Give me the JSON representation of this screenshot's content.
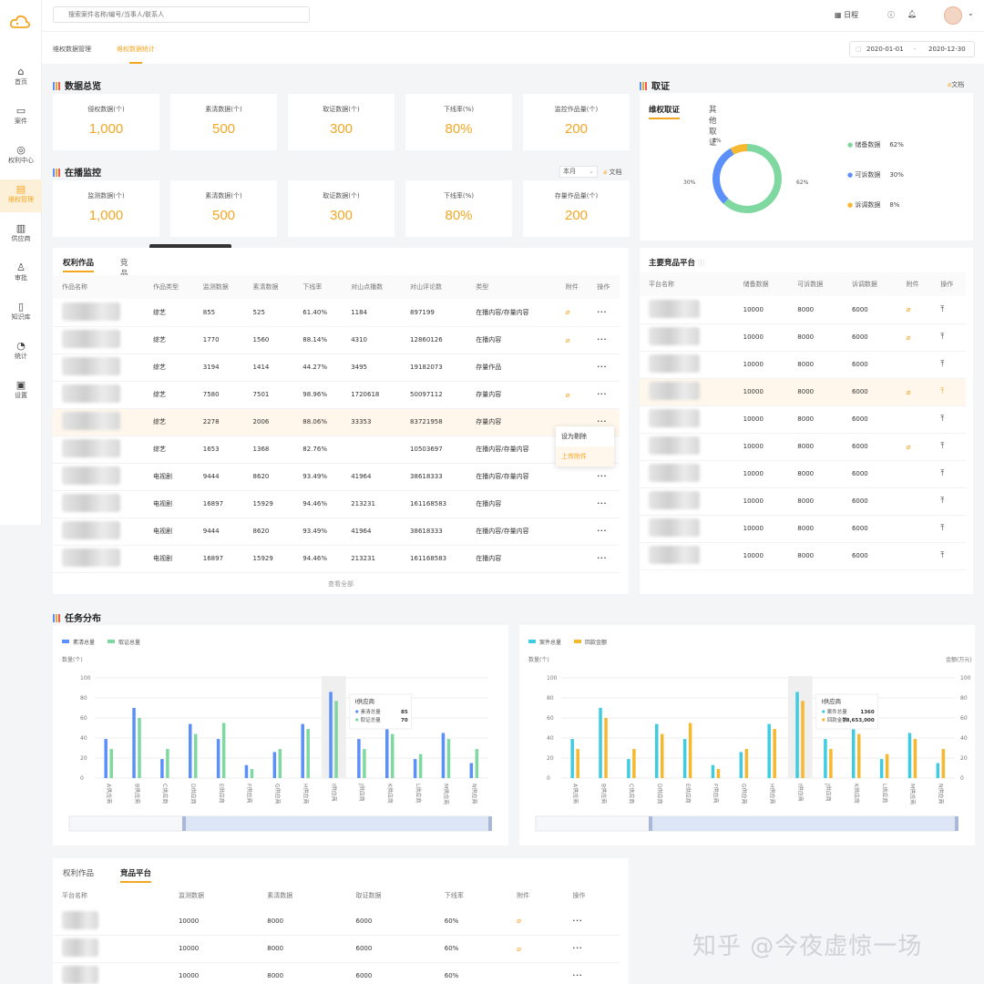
{
  "sidebar": {
    "items": [
      {
        "icon": "home-icon",
        "label": "首页"
      },
      {
        "icon": "case-icon",
        "label": "案件"
      },
      {
        "icon": "rights-icon",
        "label": "权利中心"
      },
      {
        "icon": "rights-mgmt-icon",
        "label": "维权管理"
      },
      {
        "icon": "supplier-icon",
        "label": "供应商"
      },
      {
        "icon": "user-icon",
        "label": "审批"
      },
      {
        "icon": "knowledge-icon",
        "label": "知识库"
      },
      {
        "icon": "stats-icon",
        "label": "统计"
      },
      {
        "icon": "settings-icon",
        "label": "设置"
      }
    ],
    "active": 3
  },
  "topbar": {
    "search_placeholder": "搜索案件名称/编号/当事人/联系人",
    "calendar_label": "日程",
    "help_icon": "help-icon",
    "bell_icon": "bell-icon"
  },
  "subtabs": [
    "维权数据管理",
    "维权数据统计"
  ],
  "date_range": {
    "start": "2020-01-01",
    "sep": "-",
    "end": "2020-12-30"
  },
  "overview": {
    "title": "数据总览",
    "stats": [
      {
        "label": "侵权数据(个)",
        "value": "1,000"
      },
      {
        "label": "素清数据(个)",
        "value": "500"
      },
      {
        "label": "取证数据(个)",
        "value": "300"
      },
      {
        "label": "下线率(%)",
        "value": "80%"
      },
      {
        "label": "监控作品量(个)",
        "value": "200"
      }
    ]
  },
  "monitor": {
    "title": "在播监控",
    "period": "本月",
    "doc": "文档",
    "stats": [
      {
        "label": "监测数据(个)",
        "value": "1,000"
      },
      {
        "label": "素清数据(个)",
        "value": "500"
      },
      {
        "label": "取证数据(个)",
        "value": "300"
      },
      {
        "label": "下线率(%)",
        "value": "80%"
      },
      {
        "label": "存量作品量(个)",
        "value": "200"
      }
    ]
  },
  "evidence": {
    "title": "取证",
    "doc": "文档",
    "tabs": [
      "维权取证",
      "其他取证"
    ],
    "donut": [
      {
        "name": "储备数据",
        "pct": 62,
        "color": "#7ed8a0"
      },
      {
        "name": "可诉数据",
        "pct": 30,
        "color": "#5b8ff9"
      },
      {
        "name": "诉调数据",
        "pct": 8,
        "color": "#f5b82e"
      }
    ],
    "labels": [
      "62%",
      "30%",
      "8%"
    ],
    "legend": [
      {
        "name": "储备数据",
        "pct": "62%"
      },
      {
        "name": "可诉数据",
        "pct": "30%"
      },
      {
        "name": "诉调数据",
        "pct": "8%"
      }
    ]
  },
  "works": {
    "tabs": [
      "权利作品",
      "竞品平台"
    ],
    "tooltip": "来源于竞品平台全内容的数据",
    "headers": [
      "作品名称",
      "作品类型",
      "监测数据",
      "素清数据",
      "下线率",
      "对山点播数",
      "对山评论数",
      "类型",
      "附件",
      "操作"
    ],
    "rows": [
      [
        "综艺",
        "855",
        "525",
        "61.40%",
        "1184",
        "897199",
        "在播内容/存量内容",
        true
      ],
      [
        "综艺",
        "1770",
        "1560",
        "88.14%",
        "4310",
        "12860126",
        "在播内容",
        true
      ],
      [
        "综艺",
        "3194",
        "1414",
        "44.27%",
        "3495",
        "19182073",
        "存量作品",
        false
      ],
      [
        "综艺",
        "7580",
        "7501",
        "98.96%",
        "1720618",
        "50097112",
        "存量内容",
        true
      ],
      [
        "综艺",
        "2278",
        "2006",
        "88.06%",
        "33353",
        "83721958",
        "存量内容",
        false
      ],
      [
        "综艺",
        "1653",
        "1368",
        "82.76%",
        "",
        "10503697",
        "在播内容/存量内容",
        false
      ],
      [
        "电视剧",
        "9444",
        "8620",
        "93.49%",
        "41964",
        "38618333",
        "在播内容/存量内容",
        false
      ],
      [
        "电视剧",
        "16897",
        "15929",
        "94.46%",
        "213231",
        "161168583",
        "在播内容",
        false
      ],
      [
        "电视剧",
        "9444",
        "8620",
        "93.49%",
        "41964",
        "38618333",
        "在播内容/存量内容",
        false
      ],
      [
        "电视剧",
        "16897",
        "15929",
        "94.46%",
        "213231",
        "161168583",
        "在播内容",
        false
      ]
    ],
    "more": "查看全部",
    "menu": [
      "设为剔除",
      "上传附件"
    ]
  },
  "platforms": {
    "title": "主要竞品平台",
    "headers": [
      "平台名称",
      "储备数据",
      "可诉数据",
      "诉调数据",
      "附件",
      "操作"
    ],
    "rows": [
      [
        true
      ],
      [
        true
      ],
      [
        false
      ],
      [
        true
      ],
      [
        false
      ],
      [
        true
      ],
      [
        false
      ],
      [
        false
      ],
      [
        false
      ],
      [
        false
      ]
    ],
    "values": [
      "10000",
      "8000",
      "6000"
    ]
  },
  "tasks": {
    "title": "任务分布",
    "chart_data": [
      {
        "type": "bar",
        "categories": [
          "A供应商",
          "B供应商",
          "C供应商",
          "D供应商",
          "E供应商",
          "F供应商",
          "G供应商",
          "H供应商",
          "I供应商",
          "J供应商",
          "K供应商",
          "L供应商",
          "M供应商",
          "N供应商"
        ],
        "ylabel": "数量(个)",
        "ylim": [
          0,
          100
        ],
        "series": [
          {
            "name": "素清总量",
            "color": "#5b8ff9",
            "values": [
              39,
              70,
              19,
              54,
              39,
              13,
              26,
              54,
              86,
              39,
              54,
              19,
              45,
              15
            ]
          },
          {
            "name": "取证总量",
            "color": "#7ed8a0",
            "values": [
              29,
              60,
              29,
              44,
              55,
              9,
              29,
              49,
              77,
              29,
              44,
              24,
              39,
              29
            ]
          }
        ],
        "tooltip": {
          "title": "I供应商",
          "rows": [
            {
              "name": "素清总量",
              "value": "85"
            },
            {
              "name": "取证总量",
              "value": "70"
            }
          ]
        }
      },
      {
        "type": "bar",
        "categories": [
          "A供应商",
          "B供应商",
          "C供应商",
          "D供应商",
          "E供应商",
          "F供应商",
          "G供应商",
          "H供应商",
          "I供应商",
          "J供应商",
          "K供应商",
          "L供应商",
          "M供应商",
          "N供应商"
        ],
        "ylabel_left": "数量(个)",
        "ylabel_right": "金额(万元)",
        "ylim": [
          0,
          100
        ],
        "series": [
          {
            "name": "案件总量",
            "color": "#3fcce0",
            "values": [
              39,
              70,
              19,
              54,
              39,
              13,
              26,
              54,
              86,
              39,
              54,
              19,
              45,
              15
            ]
          },
          {
            "name": "回款金额",
            "color": "#f5b82e",
            "values": [
              29,
              60,
              29,
              44,
              55,
              9,
              29,
              49,
              77,
              29,
              44,
              24,
              39,
              29
            ]
          }
        ],
        "tooltip": {
          "title": "I供应商",
          "rows": [
            {
              "name": "案件总量",
              "value": "1360"
            },
            {
              "name": "回款金额",
              "value": "78,653,000"
            }
          ]
        }
      }
    ]
  },
  "bottom": {
    "tabs": [
      "权利作品",
      "竞品平台"
    ],
    "headers": [
      "平台名称",
      "监测数据",
      "素清数据",
      "取证数据",
      "下线率",
      "附件",
      "操作"
    ],
    "rows": [
      [
        "10000",
        "8000",
        "6000",
        "60%",
        true
      ],
      [
        "10000",
        "8000",
        "6000",
        "60%",
        true
      ],
      [
        "10000",
        "8000",
        "6000",
        "60%",
        false
      ]
    ]
  },
  "watermark": "知乎 @今夜虚惊一场"
}
